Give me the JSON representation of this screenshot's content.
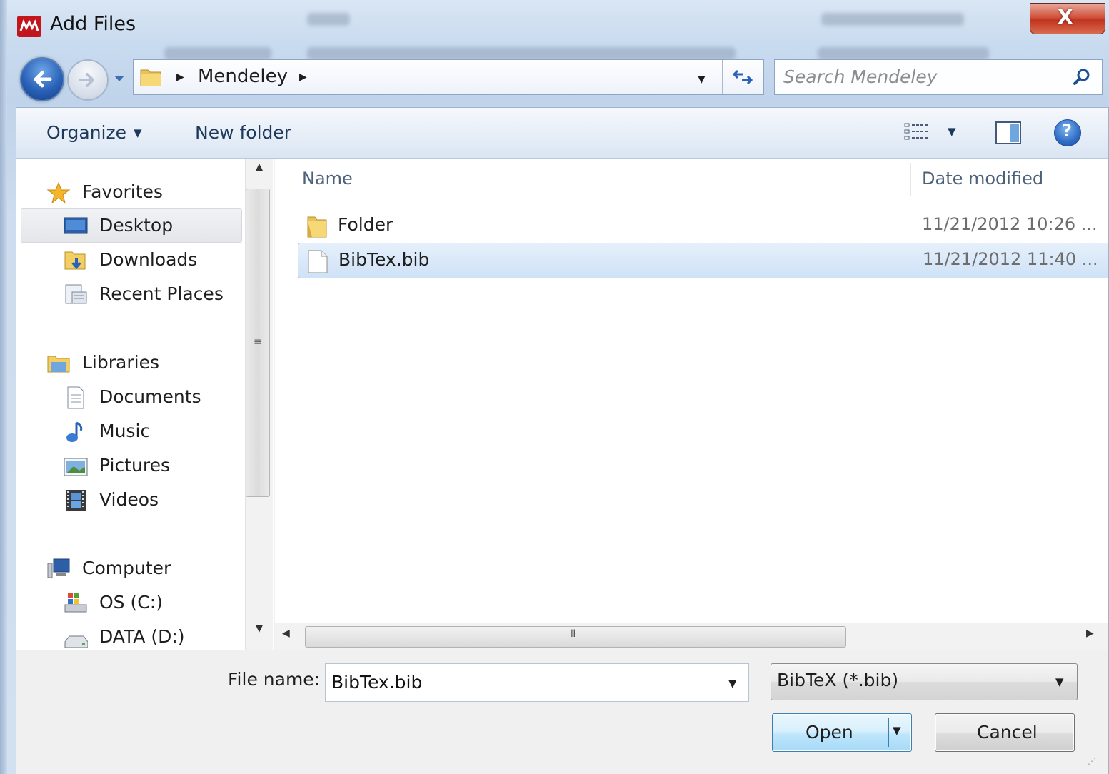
{
  "window": {
    "title": "Add Files",
    "close_label": "X"
  },
  "nav": {
    "address_segment": "Mendeley",
    "search_placeholder": "Search Mendeley"
  },
  "toolbar": {
    "organize_label": "Organize",
    "new_folder_label": "New folder",
    "help_label": "?"
  },
  "navpane": {
    "favorites": {
      "label": "Favorites",
      "items": [
        {
          "label": "Desktop",
          "icon": "desktop-icon",
          "selected": true
        },
        {
          "label": "Downloads",
          "icon": "downloads-icon"
        },
        {
          "label": "Recent Places",
          "icon": "recent-places-icon"
        }
      ]
    },
    "libraries": {
      "label": "Libraries",
      "items": [
        {
          "label": "Documents",
          "icon": "documents-icon"
        },
        {
          "label": "Music",
          "icon": "music-icon"
        },
        {
          "label": "Pictures",
          "icon": "pictures-icon"
        },
        {
          "label": "Videos",
          "icon": "videos-icon"
        }
      ]
    },
    "computer": {
      "label": "Computer",
      "items": [
        {
          "label": "OS (C:)",
          "icon": "drive-c-icon"
        },
        {
          "label": "DATA (D:)",
          "icon": "drive-d-icon"
        }
      ]
    }
  },
  "filelist": {
    "columns": {
      "name": "Name",
      "date": "Date modified"
    },
    "rows": [
      {
        "name": "Folder",
        "date": "11/21/2012 10:26 ...",
        "icon": "folder-icon",
        "selected": false
      },
      {
        "name": "BibTex.bib",
        "date": "11/21/2012 11:40 ...",
        "icon": "file-icon",
        "selected": true
      }
    ],
    "hscroll_grip": "III"
  },
  "bottom": {
    "file_name_label": "File name:",
    "file_name_value": "BibTex.bib",
    "file_type_value": "BibTeX (*.bib)",
    "open_label": "Open",
    "cancel_label": "Cancel"
  },
  "colors": {
    "accent": "#2a62b8",
    "close": "#c7432a",
    "selection": "#cfe2f7",
    "brand": "#c3161c"
  }
}
